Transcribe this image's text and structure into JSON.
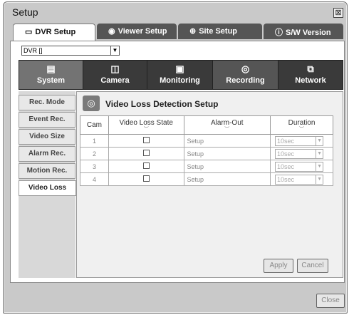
{
  "window": {
    "title": "Setup",
    "close_glyph": "⊠"
  },
  "tabs": [
    {
      "label": "DVR Setup",
      "icon": "monitor-icon"
    },
    {
      "label": "Viewer Setup",
      "icon": "viewer-icon"
    },
    {
      "label": "Site Setup",
      "icon": "globe-icon"
    },
    {
      "label": "S/W Version",
      "icon": "info-icon"
    }
  ],
  "dvr_select": {
    "value": "DVR []"
  },
  "categories": [
    {
      "label": "System",
      "icon": "system-icon"
    },
    {
      "label": "Camera",
      "icon": "camera-icon"
    },
    {
      "label": "Monitoring",
      "icon": "monitor-icon"
    },
    {
      "label": "Recording",
      "icon": "recording-icon"
    },
    {
      "label": "Network",
      "icon": "network-icon"
    }
  ],
  "sidebar": [
    "Rec. Mode",
    "Event Rec.",
    "Video Size",
    "Alarm Rec.",
    "Motion Rec.",
    "Video Loss"
  ],
  "section": {
    "title": "Video Loss Detection Setup"
  },
  "table": {
    "headers": [
      "Cam",
      "Video Loss State",
      "Alarm-Out",
      "Duration"
    ],
    "rows": [
      {
        "cam": "1",
        "alarm": "Setup",
        "duration": "10sec"
      },
      {
        "cam": "2",
        "alarm": "Setup",
        "duration": "10sec"
      },
      {
        "cam": "3",
        "alarm": "Setup",
        "duration": "10sec"
      },
      {
        "cam": "4",
        "alarm": "Setup",
        "duration": "10sec"
      }
    ]
  },
  "buttons": {
    "apply": "Apply",
    "cancel": "Cancel",
    "close": "Close"
  }
}
